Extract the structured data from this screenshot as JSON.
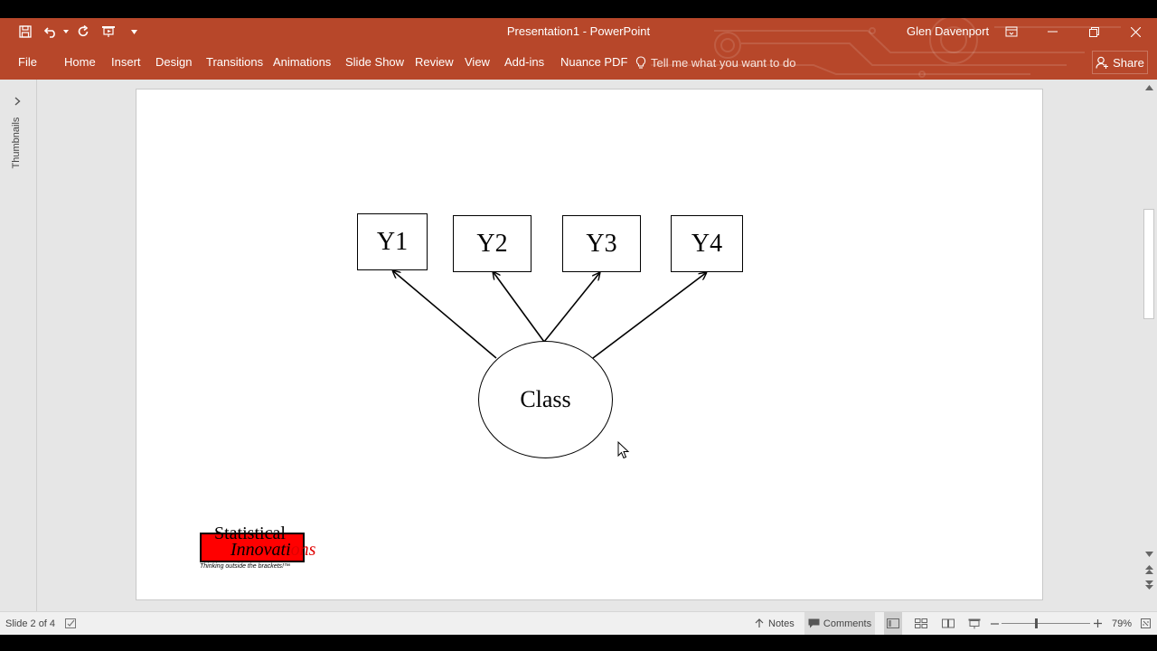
{
  "app": {
    "document_title": "Presentation1",
    "title_separator": " - ",
    "app_name": "PowerPoint",
    "user_name": "Glen Davenport",
    "accent_color": "#b7472a"
  },
  "quick_access": [
    {
      "icon": "save-icon"
    },
    {
      "icon": "undo-icon"
    },
    {
      "icon": "redo-icon"
    },
    {
      "icon": "start-from-beginning-icon"
    },
    {
      "icon": "customize-quick-access-icon"
    }
  ],
  "ribbon": {
    "tabs": [
      "File",
      "Home",
      "Insert",
      "Design",
      "Transitions",
      "Animations",
      "Slide Show",
      "Review",
      "View",
      "Add-ins",
      "Nuance PDF"
    ],
    "tell_me": "Tell me what you want to do",
    "share": "Share"
  },
  "thumbnails_pane": {
    "label": "Thumbnails"
  },
  "slide": {
    "indicators": [
      "Y1",
      "Y2",
      "Y3",
      "Y4"
    ],
    "latent": "Class",
    "logo": {
      "line1": "Statistical",
      "line2_black": "Innovati",
      "line2_red": "ons",
      "tagline": "Thinking outside the brackets!™"
    }
  },
  "statusbar": {
    "slide_info": "Slide 2 of 4",
    "notes": "Notes",
    "comments": "Comments",
    "zoom": "79%"
  }
}
